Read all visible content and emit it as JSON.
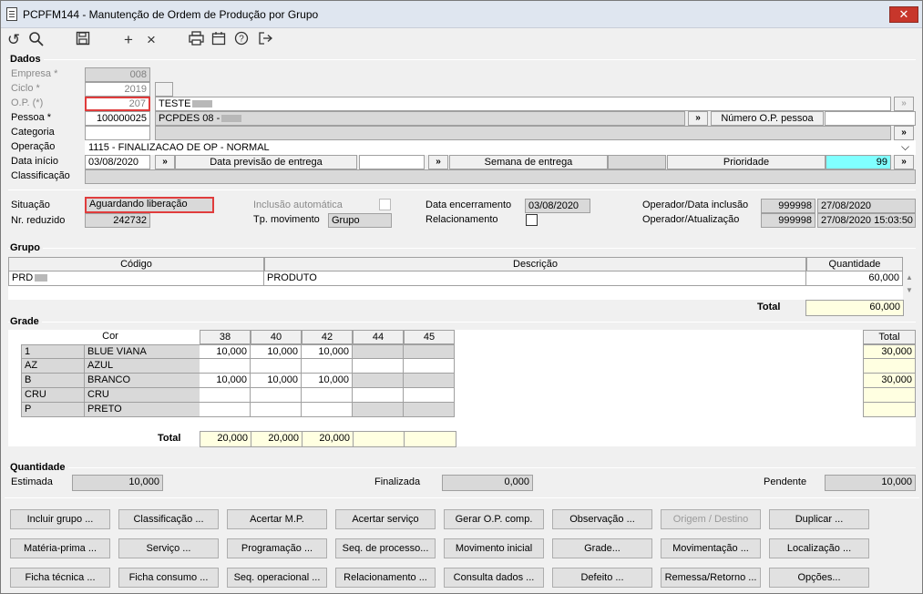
{
  "window": {
    "title": "PCPFM144 - Manutenção de Ordem de Produção por Grupo",
    "close_label": "✕"
  },
  "toolbar": {
    "icons": [
      "refresh-icon",
      "search-icon",
      "save-icon",
      "add-icon",
      "cancel-icon",
      "print-icon",
      "calendar-icon",
      "help-icon",
      "exit-icon"
    ]
  },
  "dados": {
    "section": "Dados",
    "empresa_label": "Empresa *",
    "empresa": "008",
    "ciclo_label": "Ciclo *",
    "ciclo": "2019",
    "op_label": "O.P. (*)",
    "op": "207",
    "op_desc": "TESTE",
    "pessoa_label": "Pessoa *",
    "pessoa": "100000025",
    "pessoa_desc": "PCPDES 08 -",
    "numero_op_pessoa_label": "Número O.P. pessoa",
    "numero_op_pessoa": "",
    "categoria_label": "Categoria",
    "categoria": "",
    "operacao_label": "Operação",
    "operacao": "1115 - FINALIZACAO DE OP - NORMAL",
    "data_inicio_label": "Data início",
    "data_inicio": "03/08/2020",
    "data_previsao_label": "Data previsão de entrega",
    "data_previsao": "",
    "semana_label": "Semana de entrega",
    "semana": "",
    "prioridade_label": "Prioridade",
    "prioridade": "99",
    "classificacao_label": "Classificação",
    "classificacao": ""
  },
  "status": {
    "situacao_label": "Situação",
    "situacao": "Aguardando liberação",
    "nr_reduzido_label": "Nr. reduzido",
    "nr_reduzido": "242732",
    "inclusao_auto_label": "Inclusão automática",
    "tp_movimento_label": "Tp. movimento",
    "tp_movimento": "Grupo",
    "data_encerramento_label": "Data encerramento",
    "data_encerramento": "03/08/2020",
    "relacionamento_label": "Relacionamento",
    "operador_inclusao_label": "Operador/Data inclusão",
    "operador_inclusao": "999998",
    "data_inclusao": "27/08/2020",
    "operador_atualizacao_label": "Operador/Atualização",
    "operador_atualizacao": "999998",
    "data_atualizacao": "27/08/2020 15:03:50"
  },
  "grupo": {
    "section": "Grupo",
    "columns": [
      "Código",
      "Descrição",
      "Quantidade"
    ],
    "row": {
      "codigo": "PRD",
      "descricao": "PRODUTO",
      "quantidade": "60,000"
    },
    "total_label": "Total",
    "total": "60,000"
  },
  "grade": {
    "section": "Grade",
    "cor_header": "Cor",
    "sizes": [
      "38",
      "40",
      "42",
      "44",
      "45"
    ],
    "total_header": "Total",
    "rows": [
      {
        "code": "1",
        "name": "BLUE VIANA",
        "q": [
          "10,000",
          "10,000",
          "10,000",
          "",
          ""
        ],
        "total": "30,000"
      },
      {
        "code": "AZ",
        "name": "AZUL",
        "q": [
          "",
          "",
          "",
          "",
          ""
        ],
        "total": ""
      },
      {
        "code": "B",
        "name": "BRANCO",
        "q": [
          "10,000",
          "10,000",
          "10,000",
          "",
          ""
        ],
        "total": "30,000"
      },
      {
        "code": "CRU",
        "name": "CRU",
        "q": [
          "",
          "",
          "",
          "",
          ""
        ],
        "total": ""
      },
      {
        "code": "P",
        "name": "PRETO",
        "q": [
          "",
          "",
          "",
          "",
          ""
        ],
        "total": ""
      }
    ],
    "total_label": "Total",
    "totals": [
      "20,000",
      "20,000",
      "20,000",
      "",
      ""
    ]
  },
  "quantidade": {
    "section": "Quantidade",
    "estimada_label": "Estimada",
    "estimada": "10,000",
    "finalizada_label": "Finalizada",
    "finalizada": "0,000",
    "pendente_label": "Pendente",
    "pendente": "10,000"
  },
  "buttons": [
    [
      "Incluir grupo ...",
      "Classificação ...",
      "Acertar M.P.",
      "Acertar serviço",
      "Gerar O.P. comp.",
      "Observação ...",
      "Origem / Destino",
      "Duplicar ..."
    ],
    [
      "Matéria-prima ...",
      "Serviço ...",
      "Programação ...",
      "Seq. de processo...",
      "Movimento inicial",
      "Grade...",
      "Movimentação ...",
      "Localização ..."
    ],
    [
      "Ficha técnica ...",
      "Ficha consumo ...",
      "Seq. operacional ...",
      "Relacionamento ...",
      "Consulta dados ...",
      "Defeito ...",
      "Remessa/Retorno ...",
      "Opções..."
    ]
  ]
}
